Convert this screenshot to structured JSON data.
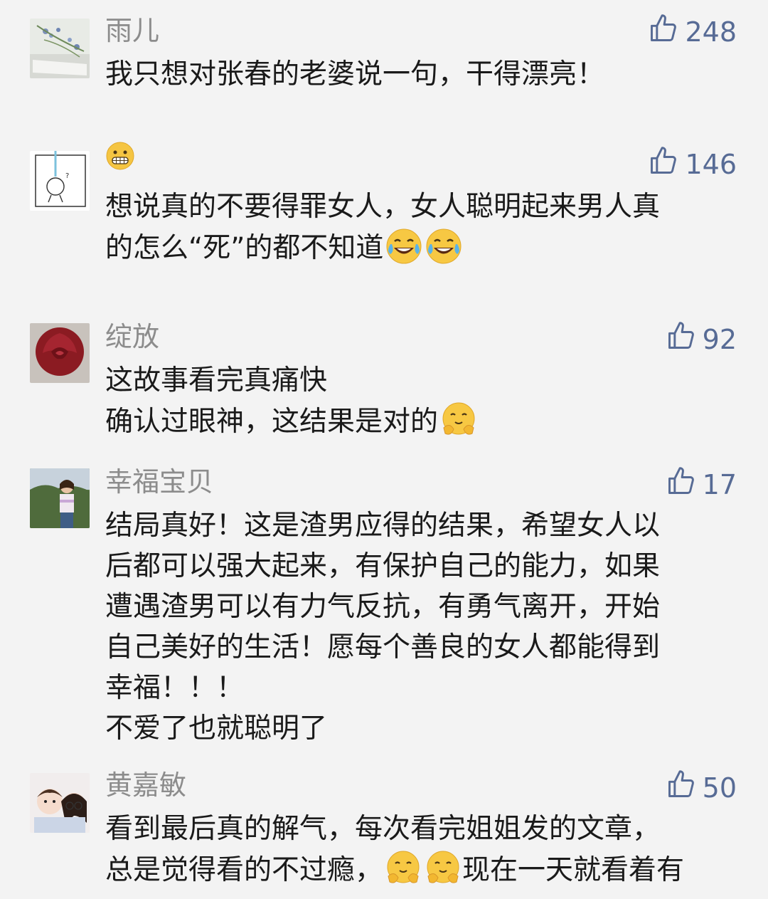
{
  "comments": [
    {
      "name": "雨儿",
      "likes": "248",
      "lines": [
        "我只想对张春的老婆说一句，干得漂亮！"
      ]
    },
    {
      "name": "😬",
      "likes": "146",
      "lines": [
        "想说真的不要得罪女人，女人聪明起来男人真",
        "的怎么“死”的都不知道"
      ],
      "emoji": "face-with-tears-of-joy"
    },
    {
      "name": "绽放",
      "likes": "92",
      "lines": [
        "这故事看完真痛快",
        "确认过眼神，这结果是对的"
      ],
      "emoji": "hugging-face"
    },
    {
      "name": "幸福宝贝",
      "likes": "17",
      "lines": [
        "结局真好！这是渣男应得的结果，希望女人以",
        "后都可以强大起来，有保护自己的能力，如果",
        "遭遇渣男可以有力气反抗，有勇气离开，开始",
        "自己美好的生活！愿每个善良的女人都能得到",
        "幸福！！！",
        "不爱了也就聪明了"
      ]
    },
    {
      "name": "黄嘉敏",
      "likes": "50",
      "lines": [
        "看到最后真的解气，每次看完姐姐发的文章，",
        "总是觉得看的不过瘾，",
        "现在一天就看着有"
      ],
      "emoji": "hugging-face"
    }
  ],
  "colors": {
    "like": "#576b95",
    "name": "#8c8c8c",
    "text": "#1a1a1a",
    "background": "#f3f3f3"
  },
  "icons": {
    "like": "thumbs-up-icon"
  }
}
